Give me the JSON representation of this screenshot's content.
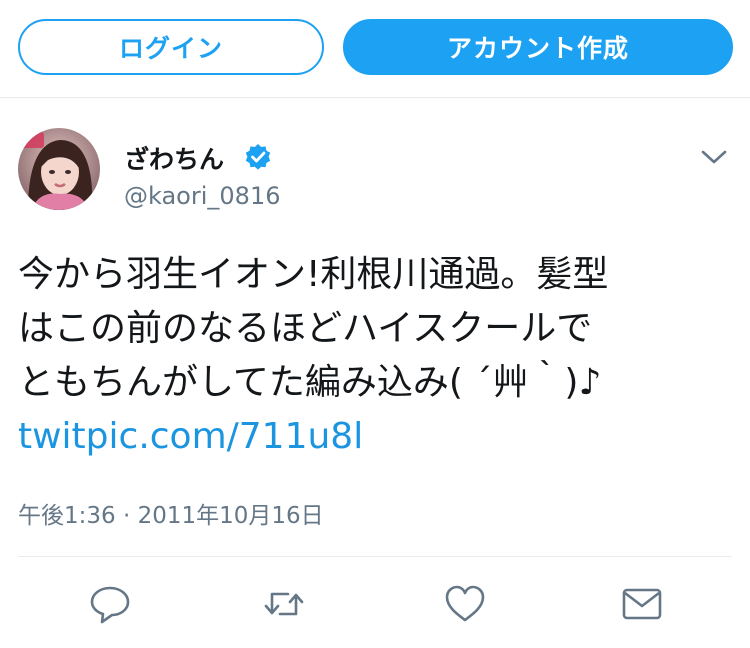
{
  "header": {
    "login_label": "ログイン",
    "signup_label": "アカウント作成"
  },
  "tweet": {
    "author": {
      "display_name": "ざわちん",
      "handle": "@kaori_0816",
      "verified": true
    },
    "text_lines": [
      "今から羽生イオン!利根川通過。髪型",
      "はこの前のなるほどハイスクールで",
      "ともちんがしてた編み込み( ´艸｀)♪"
    ],
    "link": "twitpic.com/711u8l",
    "timestamp": "午後1:36 · 2011年10月16日"
  },
  "icons": {
    "verified": "verified-badge-icon",
    "menu": "chevron-down-icon",
    "reply": "reply-icon",
    "retweet": "retweet-icon",
    "like": "heart-icon",
    "dm": "envelope-icon"
  },
  "colors": {
    "accent": "#1da1f2",
    "link": "#1b95e0",
    "muted": "#657786",
    "text": "#14171a",
    "divider": "#e6ecf0"
  }
}
